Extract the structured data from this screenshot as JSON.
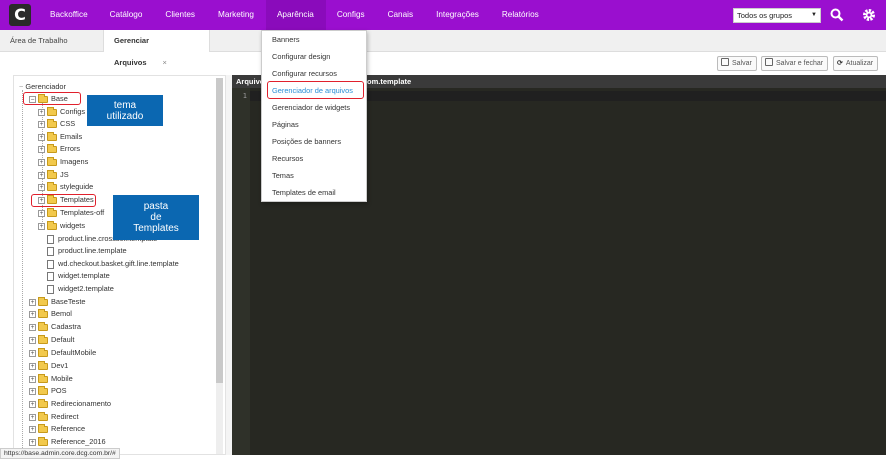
{
  "app": {
    "logo_letter": "C"
  },
  "nav": {
    "items": [
      {
        "label": "Backoffice"
      },
      {
        "label": "Catálogo"
      },
      {
        "label": "Clientes"
      },
      {
        "label": "Marketing"
      },
      {
        "label": "Aparência",
        "active": true
      },
      {
        "label": "Configs"
      },
      {
        "label": "Canais"
      },
      {
        "label": "Integrações"
      },
      {
        "label": "Relatórios"
      }
    ],
    "group_select": "Todos os grupos",
    "search_icon": "search-icon",
    "settings_icon": "gear-icon",
    "accent_color": "#9a0fcf"
  },
  "tabs": [
    {
      "label": "Área de Trabalho"
    },
    {
      "label": "Gerenciar Arquivos",
      "active": true,
      "close": "×"
    }
  ],
  "toolbar": {
    "save_label": "Salvar",
    "save_close_label": "Salvar e fechar",
    "refresh_label": "Atualizar"
  },
  "dropdown": {
    "items": [
      {
        "label": "Banners"
      },
      {
        "label": "Configurar design"
      },
      {
        "label": "Configurar recursos"
      },
      {
        "label": "Gerenciador de arquivos",
        "highlight": true
      },
      {
        "label": "Gerenciador de widgets"
      },
      {
        "label": "Páginas"
      },
      {
        "label": "Posições de banners"
      },
      {
        "label": "Recursos"
      },
      {
        "label": "Temas"
      },
      {
        "label": "Templates de email"
      }
    ]
  },
  "tree": {
    "root": "Gerenciador",
    "base": "Base",
    "base_children": [
      "Configs",
      "CSS",
      "Emails",
      "Errors",
      "Imagens",
      "JS",
      "styleguide",
      "Templates",
      "Templates-off",
      "widgets"
    ],
    "base_files": [
      "product.line.crosssell.template",
      "product.line.template",
      "wd.checkout.basket.gift.line.template",
      "widget.template",
      "widget2.template"
    ],
    "themes": [
      "BaseTeste",
      "Bemol",
      "Cadastra",
      "Default",
      "DefaultMobile",
      "Dev1",
      "Mobile",
      "POS",
      "Redirecionamento",
      "Redirect",
      "Reference",
      "Reference_2016"
    ]
  },
  "editor": {
    "header_prefix": "Arquivo",
    "header_suffix": "om.template",
    "line_number": "1"
  },
  "annotations": {
    "theme_note": "tema\nutilizado",
    "templates_note": "pasta\nde\nTemplates"
  },
  "status_url": "https://base.admin.core.dcg.com.br/#"
}
